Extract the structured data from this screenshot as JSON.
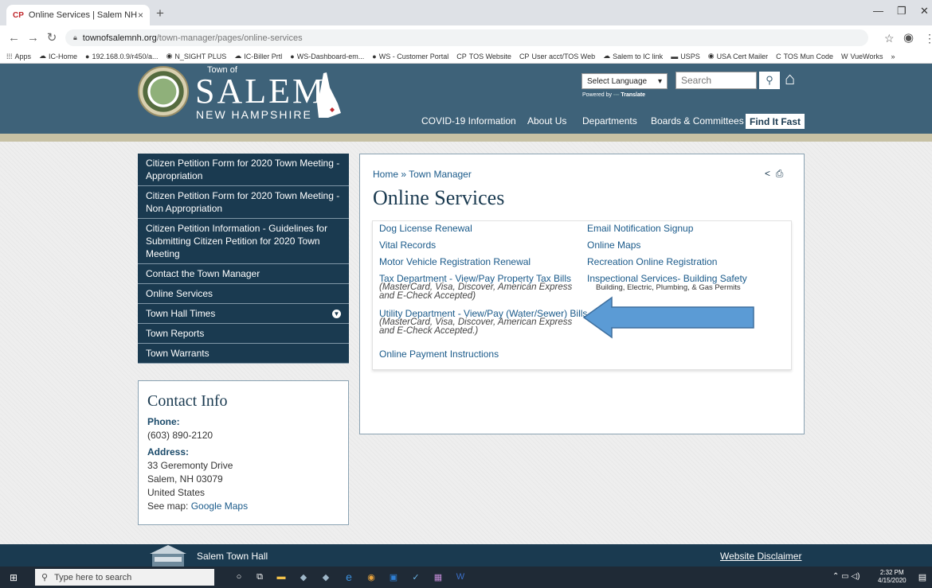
{
  "browser": {
    "tab_title": "Online Services | Salem NH",
    "tab_favicon": "CP",
    "tab_close": "×",
    "new_tab": "+",
    "url_host": "townofsalemnh.org",
    "url_path": "/town-manager/pages/online-services",
    "bookmarks": [
      {
        "icon": "apps-icon",
        "glyph": "⁞⁞⁞",
        "label": "Apps"
      },
      {
        "icon": "cloud-icon",
        "glyph": "☁",
        "label": "IC-Home"
      },
      {
        "icon": "globe-icon",
        "glyph": "●",
        "label": "192.168.0.9/r450/a..."
      },
      {
        "icon": "chrome-icon",
        "glyph": "◉",
        "label": "N_SIGHT PLUS"
      },
      {
        "icon": "cloud-icon",
        "glyph": "☁",
        "label": "IC-Biller Prtl"
      },
      {
        "icon": "globe-icon",
        "glyph": "●",
        "label": "WS-Dashboard-em..."
      },
      {
        "icon": "globe-icon",
        "glyph": "●",
        "label": "WS - Customer Portal"
      },
      {
        "icon": "cp-icon",
        "glyph": "CP",
        "label": "TOS Website"
      },
      {
        "icon": "cp-icon",
        "glyph": "CP",
        "label": "User acct/TOS Web"
      },
      {
        "icon": "cloud-icon",
        "glyph": "☁",
        "label": "Salem to IC link"
      },
      {
        "icon": "usps-icon",
        "glyph": "▬",
        "label": "USPS"
      },
      {
        "icon": "chrome-icon",
        "glyph": "◉",
        "label": "USA Cert Mailer"
      },
      {
        "icon": "c-icon",
        "glyph": "C",
        "label": "TOS Mun Code"
      },
      {
        "icon": "vueworks-icon",
        "glyph": "W",
        "label": "VueWorks"
      },
      {
        "icon": "more-icon",
        "glyph": "»",
        "label": ""
      }
    ]
  },
  "site": {
    "town_of": "Town of",
    "name": "SALEM",
    "state": "NEW HAMPSHIRE",
    "language_select": "Select Language",
    "powered_by": "Powered by",
    "translate": "Translate",
    "search_placeholder": "Search",
    "nav": [
      {
        "label": "COVID-19 Information"
      },
      {
        "label": "About Us"
      },
      {
        "label": "Departments"
      },
      {
        "label": "Boards & Committees"
      }
    ],
    "find_it_fast": "Find It Fast"
  },
  "sidebar": {
    "items": [
      {
        "label": "Citizen Petition Form for 2020 Town Meeting - Appropriation"
      },
      {
        "label": "Citizen Petition Form for 2020 Town Meeting - Non Appropriation"
      },
      {
        "label": "Citizen Petition Information - Guidelines for Submitting Citizen Petition for 2020 Town Meeting"
      },
      {
        "label": "Contact the Town Manager"
      },
      {
        "label": "Online Services"
      },
      {
        "label": "Town Hall Times"
      },
      {
        "label": "Town Reports"
      },
      {
        "label": "Town Warrants"
      }
    ]
  },
  "contact": {
    "title": "Contact Info",
    "phone_label": "Phone:",
    "phone": "(603) 890-2120",
    "address_label": "Address:",
    "street": "33 Geremonty Drive",
    "city": "Salem, NH 03079",
    "country": "United States",
    "map_prefix": "See map:",
    "map_link": "Google Maps"
  },
  "main": {
    "breadcrumb": "Home » Town Manager",
    "title": "Online Services",
    "links": {
      "dog": "Dog License Renewal",
      "vital": "Vital Records",
      "motor": "Motor Vehicle Registration Renewal",
      "tax": "Tax Department - View/Pay Property Tax Bills",
      "tax_note_1": "(MasterCard, Visa, Discover, American Express",
      "tax_note_2": "and E-Check Accepted)",
      "utility": "Utility Department - View/Pay (Water/Sewer) Bills",
      "utility_note_1": "(MasterCard, Visa, Discover, American Express",
      "utility_note_2": "and E-Check Accepted.)",
      "payment": "Online Payment Instructions",
      "email": "Email Notification Signup",
      "maps": "Online Maps",
      "recreation": "Recreation Online Registration",
      "inspect": "Inspectional Services- Building Safety",
      "inspect_sub": "Building, Electric, Plumbing, & Gas Permits"
    }
  },
  "footer": {
    "title": "Salem Town Hall",
    "disclaimer": "Website Disclaimer"
  },
  "taskbar": {
    "search_placeholder": "Type here to search",
    "time": "2:32 PM",
    "date": "4/15/2020"
  },
  "colors": {
    "header": "#3e6279",
    "menu": "#1a3a50",
    "link": "#1a5a8a",
    "arrow": "#5b9bd5"
  }
}
